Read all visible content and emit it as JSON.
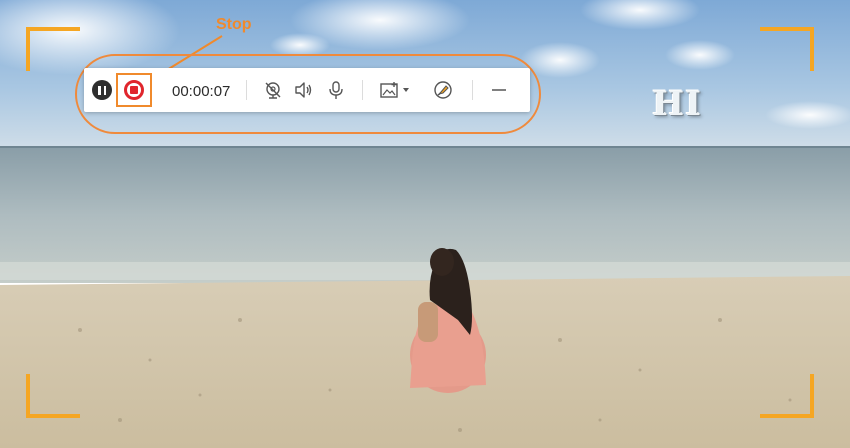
{
  "annotation": {
    "callout_label": "Stop",
    "accent_color": "#f08a2c"
  },
  "overlay": {
    "corner_color": "#f5a623",
    "video_caption": "HI"
  },
  "toolbar": {
    "timer": "00:00:07",
    "buttons": [
      {
        "name": "pause",
        "icon": "pause-icon"
      },
      {
        "name": "stop",
        "icon": "stop-icon",
        "color": "#e0262d"
      },
      {
        "name": "webcam",
        "icon": "webcam-off-icon"
      },
      {
        "name": "speaker",
        "icon": "speaker-icon"
      },
      {
        "name": "microphone",
        "icon": "microphone-icon"
      },
      {
        "name": "screenshot",
        "icon": "screenshot-dropdown-icon"
      },
      {
        "name": "annotate",
        "icon": "pen-icon"
      },
      {
        "name": "minimize",
        "icon": "minimize-icon"
      }
    ]
  }
}
